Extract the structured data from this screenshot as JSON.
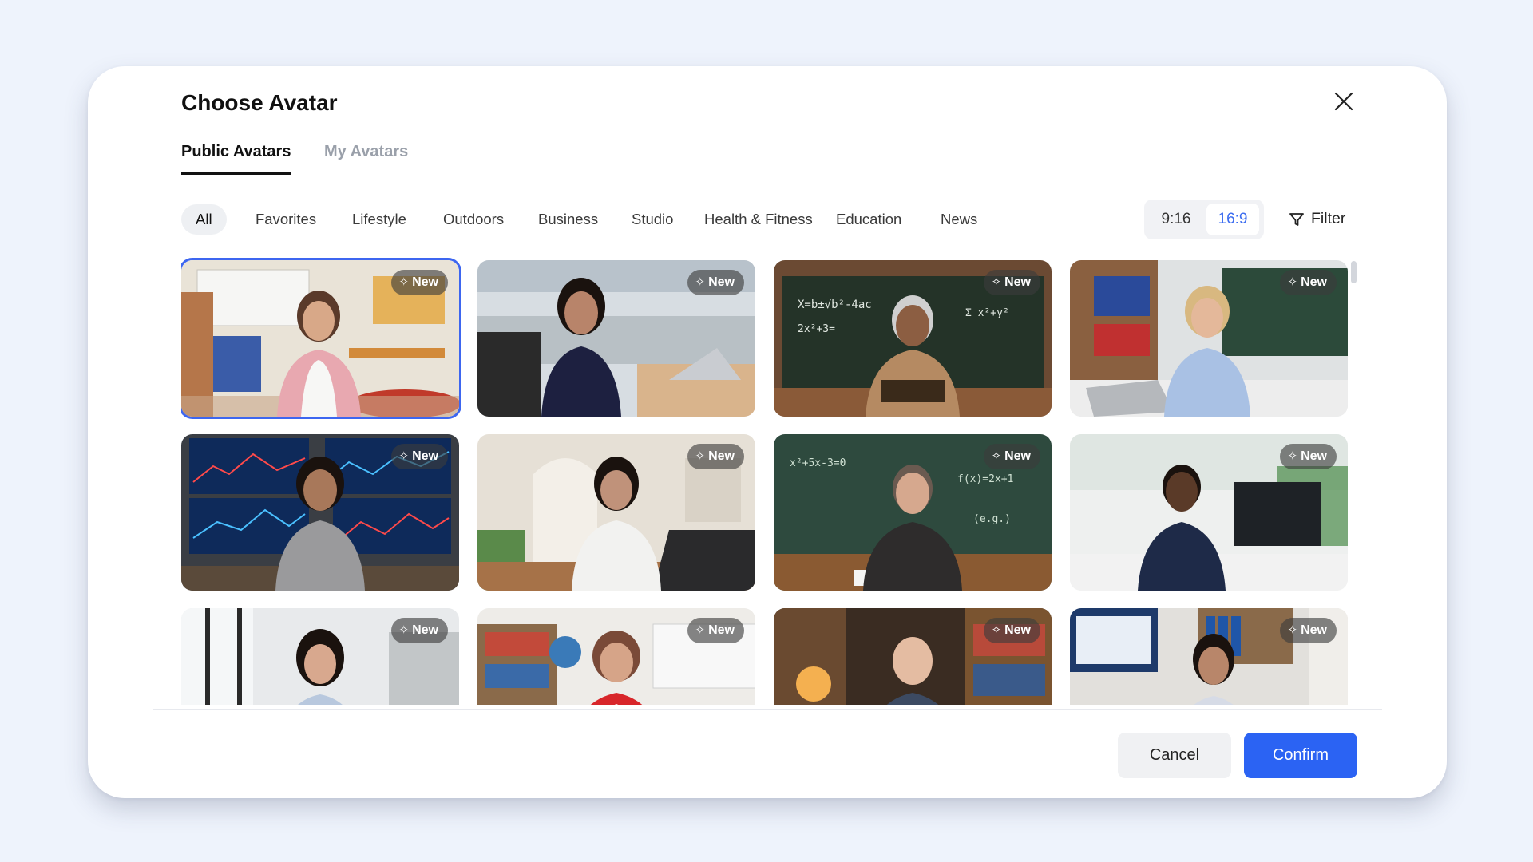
{
  "dialog": {
    "title": "Choose Avatar"
  },
  "tabs": [
    {
      "label": "Public Avatars",
      "active": true
    },
    {
      "label": "My Avatars",
      "active": false
    }
  ],
  "categories": [
    "All",
    "Favorites",
    "Lifestyle",
    "Outdoors",
    "Business",
    "Studio",
    "Health & Fitness",
    "Education",
    "News"
  ],
  "active_category": "All",
  "aspect_ratio": {
    "options": [
      "9:16",
      "16:9"
    ],
    "selected": "16:9"
  },
  "filter_label": "Filter",
  "new_badge": "New",
  "avatars": [
    {
      "scene": "classroom",
      "badge": true,
      "selected": true
    },
    {
      "scene": "office",
      "badge": true
    },
    {
      "scene": "chalkboard",
      "badge": true
    },
    {
      "scene": "bookshelf-office",
      "badge": true
    },
    {
      "scene": "trading-desk",
      "badge": true
    },
    {
      "scene": "home-office",
      "badge": true
    },
    {
      "scene": "chalkboard",
      "badge": true
    },
    {
      "scene": "tech-office",
      "badge": true
    },
    {
      "scene": "window-office",
      "badge": true
    },
    {
      "scene": "library",
      "badge": true
    },
    {
      "scene": "study",
      "badge": true
    },
    {
      "scene": "data-office",
      "badge": true
    }
  ],
  "actions": {
    "cancel": "Cancel",
    "confirm": "Confirm"
  },
  "colors": {
    "accent": "#2b63f3",
    "selected_outline": "#3d66f0",
    "ratio_active": "#3b6cf0"
  }
}
